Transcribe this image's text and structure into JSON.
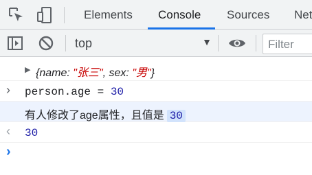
{
  "tabs": {
    "elements": "Elements",
    "console": "Console",
    "sources": "Sources",
    "network": "Net"
  },
  "toolbar": {
    "context": "top",
    "caret": "▼",
    "filter_placeholder": "Filter"
  },
  "console": {
    "object_line": {
      "open": "{",
      "name_key": "name: ",
      "name_value": "\"张三\"",
      "sep": ", ",
      "sex_key": "sex: ",
      "sex_value": "\"男\"",
      "close": "}"
    },
    "input": {
      "expr": "person.age = ",
      "value": "30"
    },
    "log": {
      "message": "有人修改了age属性，且值是",
      "value": "30"
    },
    "result": "30",
    "glyphs": {
      "input_arrow": "›",
      "result_arrow": "‹",
      "prompt_arrow": "›",
      "expand_caret": "▶"
    }
  },
  "colors": {
    "accent": "#1a73e8",
    "string": "#c80000",
    "number": "#1a1aa6",
    "log_highlight": "#edf3fe"
  },
  "icons": [
    "inspect-element-icon",
    "device-toolbar-icon",
    "sidebar-toggle-icon",
    "clear-console-icon",
    "eye-icon"
  ]
}
